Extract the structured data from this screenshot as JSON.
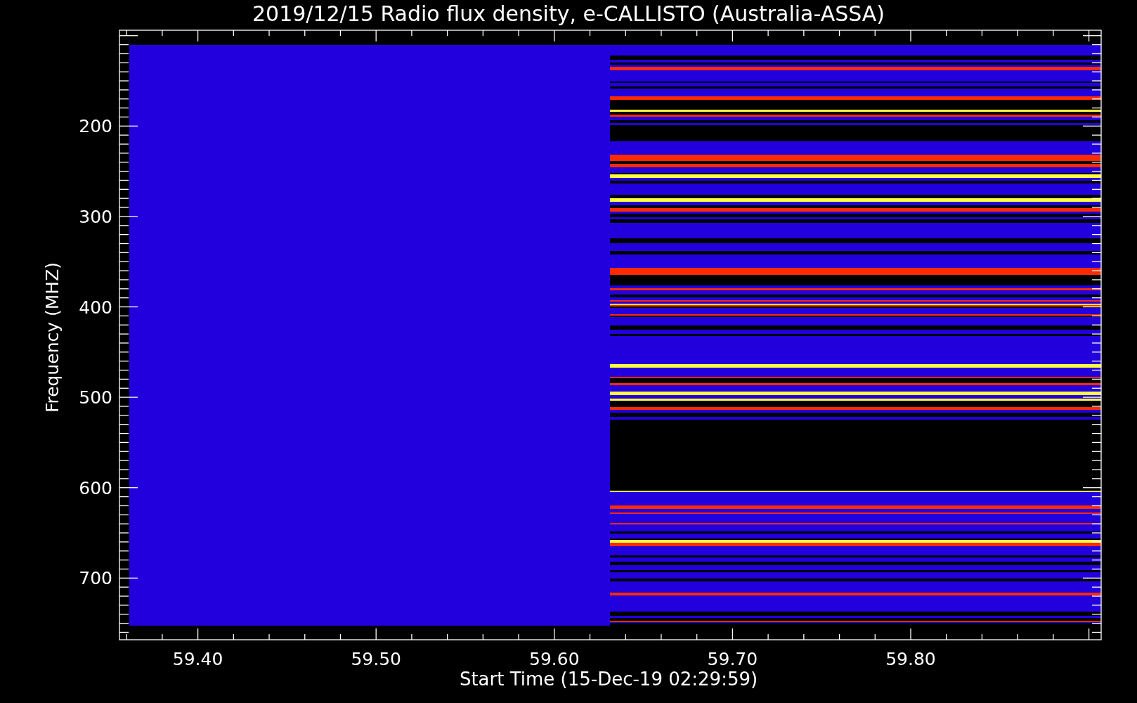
{
  "plot": {
    "title": "2019/12/15  Radio flux density, e-CALLISTO (Australia-ASSA)",
    "x_axis": {
      "label": "Start Time (15-Dec-19 02:29:59)",
      "tick_labels": [
        "59.40",
        "59.50",
        "59.60",
        "59.70",
        "59.80"
      ]
    },
    "y_axis": {
      "label": "Frequency (MHZ)",
      "tick_labels": [
        "200",
        "300",
        "400",
        "500",
        "600",
        "700"
      ]
    }
  }
}
